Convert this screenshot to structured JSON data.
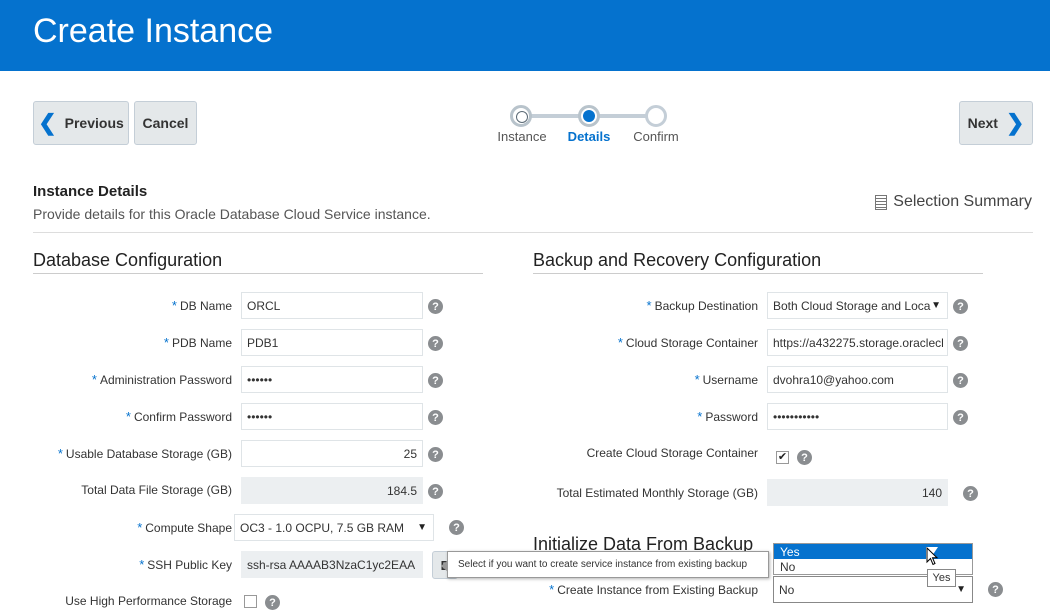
{
  "page": {
    "title": "Create Instance"
  },
  "nav": {
    "previous_label": "Previous",
    "cancel_label": "Cancel",
    "next_label": "Next"
  },
  "train": {
    "steps": [
      "Instance",
      "Details",
      "Confirm"
    ],
    "current_step": "Details"
  },
  "section": {
    "title": "Instance Details",
    "description": "Provide details for this Oracle Database Cloud Service instance.",
    "summary_label": "Selection Summary"
  },
  "db_config": {
    "title": "Database Configuration",
    "db_name": {
      "label": "DB Name",
      "value": "ORCL"
    },
    "pdb_name": {
      "label": "PDB Name",
      "value": "PDB1"
    },
    "admin_password": {
      "label": "Administration Password",
      "value": "••••••"
    },
    "confirm_password": {
      "label": "Confirm Password",
      "value": "••••••"
    },
    "usable_storage": {
      "label": "Usable Database Storage (GB)",
      "value": "25"
    },
    "total_file_storage": {
      "label": "Total Data File Storage (GB)",
      "value": "184.5"
    },
    "compute_shape": {
      "label": "Compute Shape",
      "value": "OC3 - 1.0 OCPU, 7.5 GB RAM"
    },
    "ssh_key": {
      "label": "SSH Public Key",
      "value": "ssh-rsa AAAAB3NzaC1yc2EAA",
      "edit_label": "E"
    },
    "high_perf": {
      "label": "Use High Performance Storage"
    }
  },
  "backup_config": {
    "title": "Backup and Recovery Configuration",
    "destination": {
      "label": "Backup Destination",
      "value": "Both Cloud Storage and Loca"
    },
    "container": {
      "label": "Cloud Storage Container",
      "value": "https://a432275.storage.oraclecl"
    },
    "username": {
      "label": "Username",
      "value": "dvohra10@yahoo.com"
    },
    "password": {
      "label": "Password",
      "value": "•••••••••••"
    },
    "create_container": {
      "label": "Create Cloud Storage Container",
      "checked": true,
      "check_glyph": "✔"
    },
    "estimated_storage": {
      "label": "Total Estimated Monthly Storage (GB)",
      "value": "140"
    }
  },
  "init_backup": {
    "title": "Initialize Data From Backup",
    "create_from_backup": {
      "label": "Create Instance from Existing Backup",
      "value": "No"
    },
    "tooltip": "Select if you want to create service instance from existing backup",
    "options": [
      "Yes",
      "No"
    ],
    "highlighted": "Yes",
    "hover_tip": "Yes"
  },
  "glyphs": {
    "help": "?",
    "caret": "▼",
    "chev_left": "❮",
    "chev_right": "❯",
    "required": "*"
  },
  "colors": {
    "brand": "#0572ce",
    "header_bg": "#0572ce"
  }
}
